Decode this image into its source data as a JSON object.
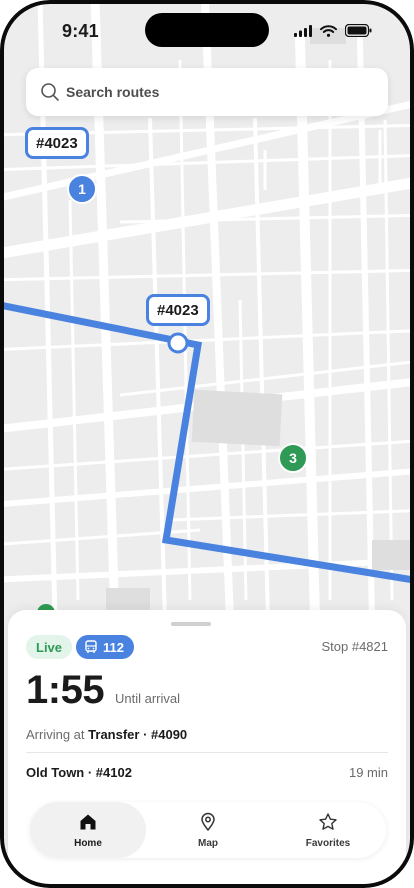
{
  "status_bar": {
    "time": "9:41"
  },
  "search": {
    "placeholder": "Search routes",
    "value": ""
  },
  "map": {
    "route_labels": [
      "#4023",
      "#4023"
    ],
    "stop_markers": [
      {
        "label": "1",
        "color": "#4a82e0"
      },
      {
        "label": "3",
        "color": "#2f9a55"
      }
    ],
    "route_color": "#4a82e0"
  },
  "sheet": {
    "status_badge": "Live",
    "route_badge": "112",
    "stop_id": "Stop #4821",
    "eta": "1:55",
    "eta_label": "Until arrival",
    "arriving_prefix": "Arriving at",
    "arriving_stop": "Transfer · #4090",
    "next_stop": "Old Town · #4102",
    "next_time": "19 min"
  },
  "tabs": [
    {
      "label": "Home",
      "icon": "home-icon",
      "active": true
    },
    {
      "label": "Map",
      "icon": "map-pin-icon",
      "active": false
    },
    {
      "label": "Favorites",
      "icon": "star-icon",
      "active": false
    }
  ],
  "colors": {
    "accent": "#4a82e0",
    "live": "#2f9a55",
    "live_bg": "#e3f4ea"
  }
}
